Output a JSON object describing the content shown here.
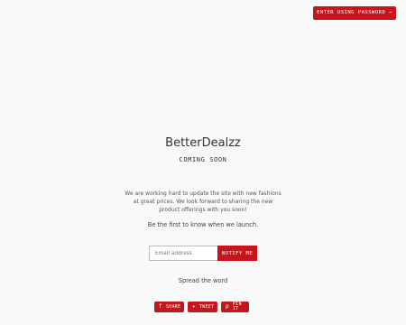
{
  "header": {
    "password_button": "ENTER USING PASSWORD →"
  },
  "main": {
    "shop_name": "BetterDealzz",
    "status": "COMING SOON",
    "message": "We are working hard to update the site with new fashions at great prices. We look forward to sharing the new product offerings with you soon!",
    "signup_prompt": "Be the first to know when we launch."
  },
  "signup": {
    "email_placeholder": "Email address",
    "notify_label": "NOTIFY ME"
  },
  "social": {
    "heading": "Spread the word",
    "share_label": "SHARE",
    "share_icon": "facebook-icon",
    "tweet_label": "TWEET",
    "tweet_icon": "twitter-icon",
    "pin_label": "PIN IT",
    "pin_icon": "pinterest-icon"
  },
  "colors": {
    "accent": "#c4161c",
    "background": "#f9f9f9"
  }
}
